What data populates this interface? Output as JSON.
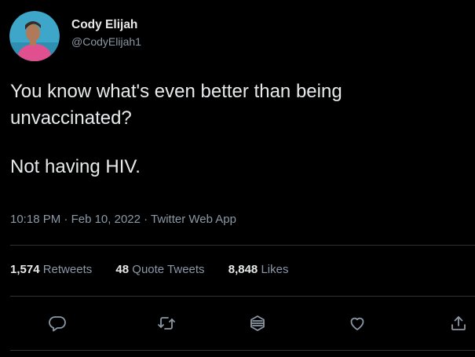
{
  "tweet": {
    "author": {
      "display_name": "Cody Elijah",
      "handle": "@CodyElijah1",
      "avatar_bg": "#3ea6c8",
      "avatar_shirt": "#e0508f",
      "avatar_skin": "#b07a5a"
    },
    "text": {
      "line1": "You know what's even better than being",
      "line2": "unvaccinated?",
      "line3": "Not having HIV."
    },
    "meta": {
      "time": "10:18 PM",
      "separator": "·",
      "date": "Feb 10, 2022",
      "app": "Twitter Web App"
    },
    "stats": {
      "retweets_count": "1,574",
      "retweets_label": "Retweets",
      "quote_count": "48",
      "quote_label": "Quote Tweets",
      "likes_count": "8,848",
      "likes_label": "Likes"
    },
    "actions": {
      "reply_icon": "reply-icon",
      "retweet_icon": "retweet-icon",
      "nft_icon": "hexagon-icon",
      "like_icon": "heart-icon",
      "share_icon": "share-icon"
    }
  },
  "colors": {
    "background": "#000000",
    "text_primary": "#e7e9ea",
    "text_secondary": "#8b98a5",
    "divider": "#2f3336"
  }
}
